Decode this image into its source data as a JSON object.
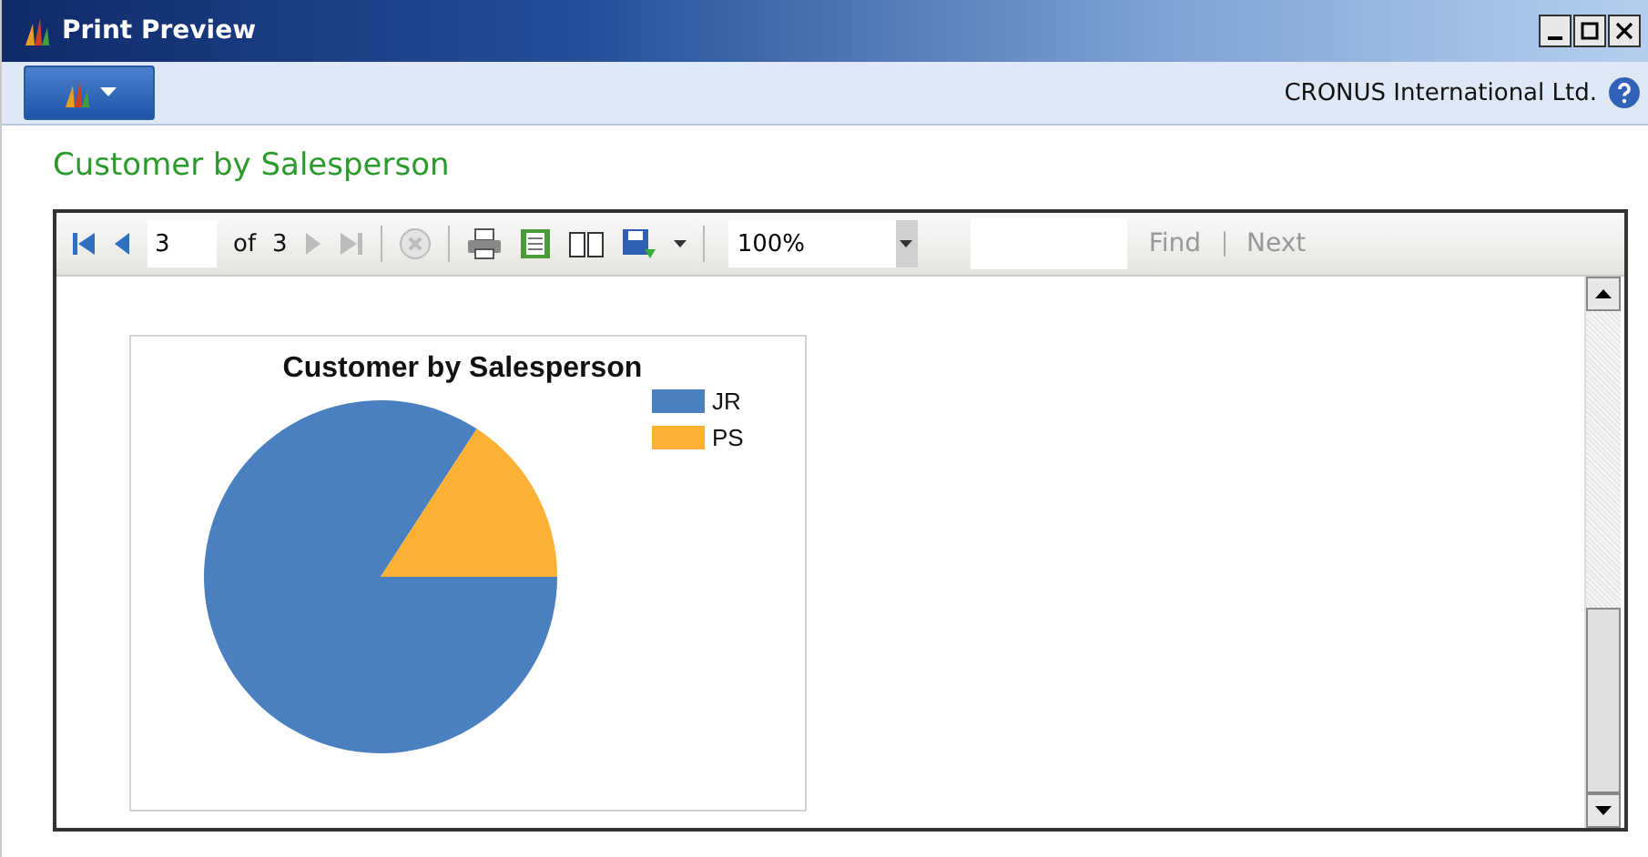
{
  "window": {
    "title": "Print Preview"
  },
  "ribbon": {
    "company": "CRONUS International Ltd."
  },
  "page_title": "Customer by Salesperson",
  "viewer": {
    "page": "3",
    "of_label": "of",
    "page_count": "3",
    "zoom": "100%",
    "find_label": "Find",
    "next_label": "Next",
    "chart": {
      "title": "Customer by Salesperson",
      "legend": [
        {
          "label": "JR",
          "color": "#4a80c0"
        },
        {
          "label": "PS",
          "color": "#fbb234"
        }
      ]
    }
  }
}
